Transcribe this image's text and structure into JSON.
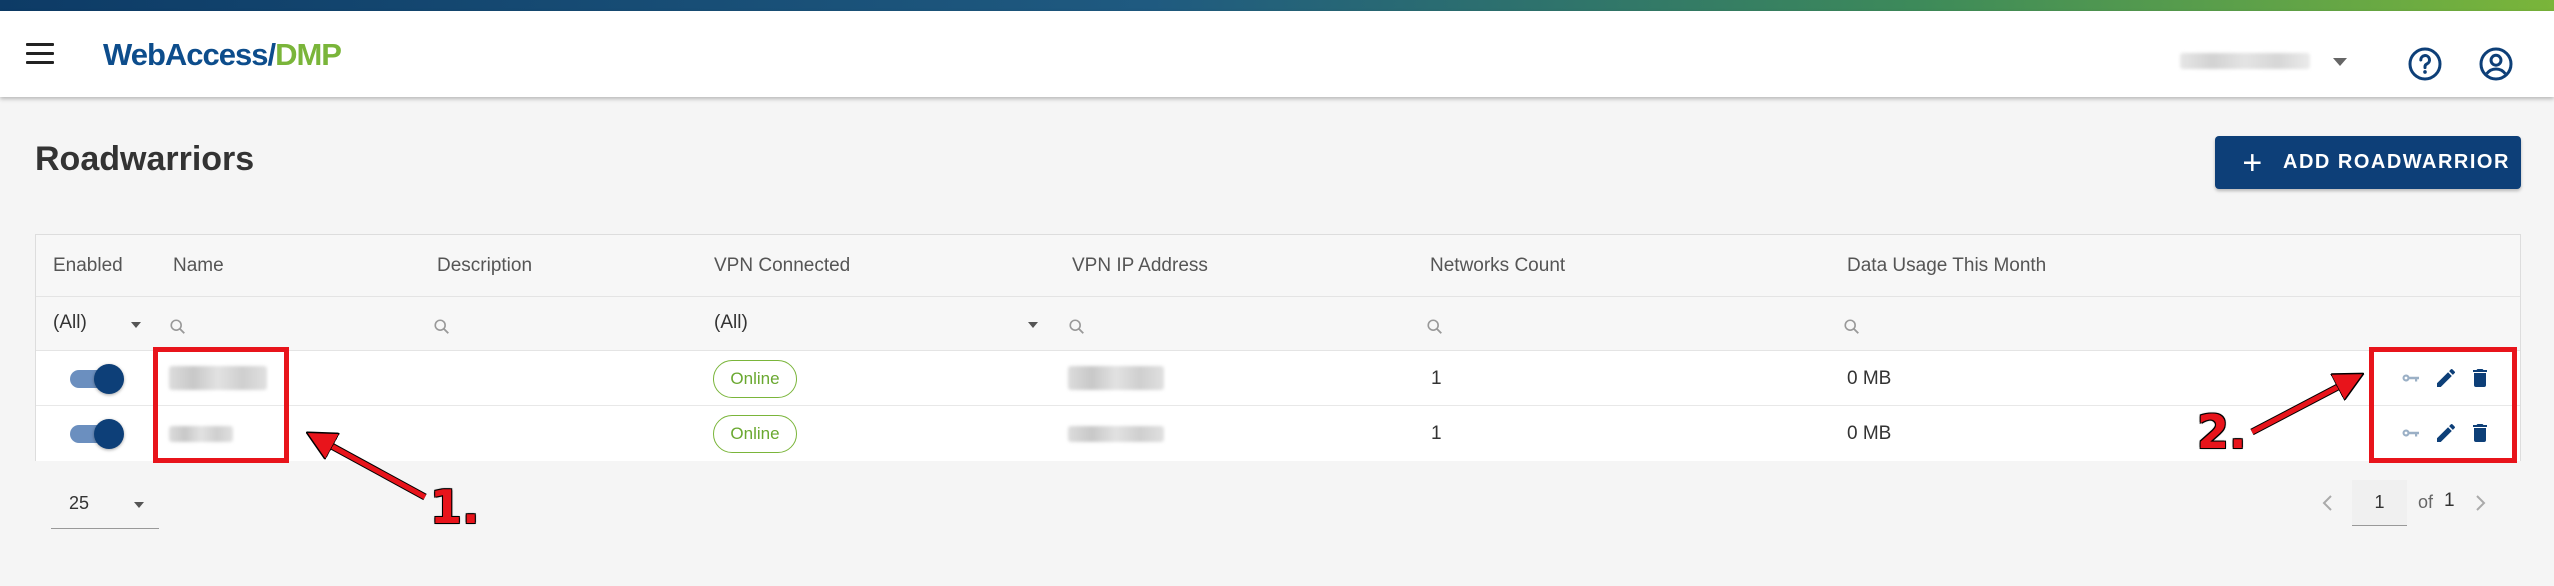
{
  "app": {
    "logo_part1": "WebAccess/",
    "logo_part2": "DMP"
  },
  "page": {
    "title": "Roadwarriors",
    "add_button_label": "ADD ROADWARRIOR"
  },
  "grid": {
    "columns": [
      "Enabled",
      "Name",
      "Description",
      "VPN Connected",
      "VPN IP Address",
      "Networks Count",
      "Data Usage This Month"
    ],
    "filters": {
      "enabled": "(All)",
      "vpn_connected": "(All)"
    },
    "rows": [
      {
        "enabled": true,
        "vpn_connected": "Online",
        "networks_count": "1",
        "data_usage": "0 MB"
      },
      {
        "enabled": true,
        "vpn_connected": "Online",
        "networks_count": "1",
        "data_usage": "0 MB"
      }
    ],
    "row_actions": [
      "key-icon",
      "edit-icon",
      "delete-icon"
    ]
  },
  "pager": {
    "page_size": "25",
    "current_page": "1",
    "of_label": "of",
    "total_pages": "1"
  },
  "annotations": {
    "label_1": "1.",
    "label_2": "2.",
    "color": "#e8141b"
  },
  "colors": {
    "brand_blue": "#0d3f78",
    "brand_green": "#7ab53a",
    "online_green": "#6aa830"
  }
}
